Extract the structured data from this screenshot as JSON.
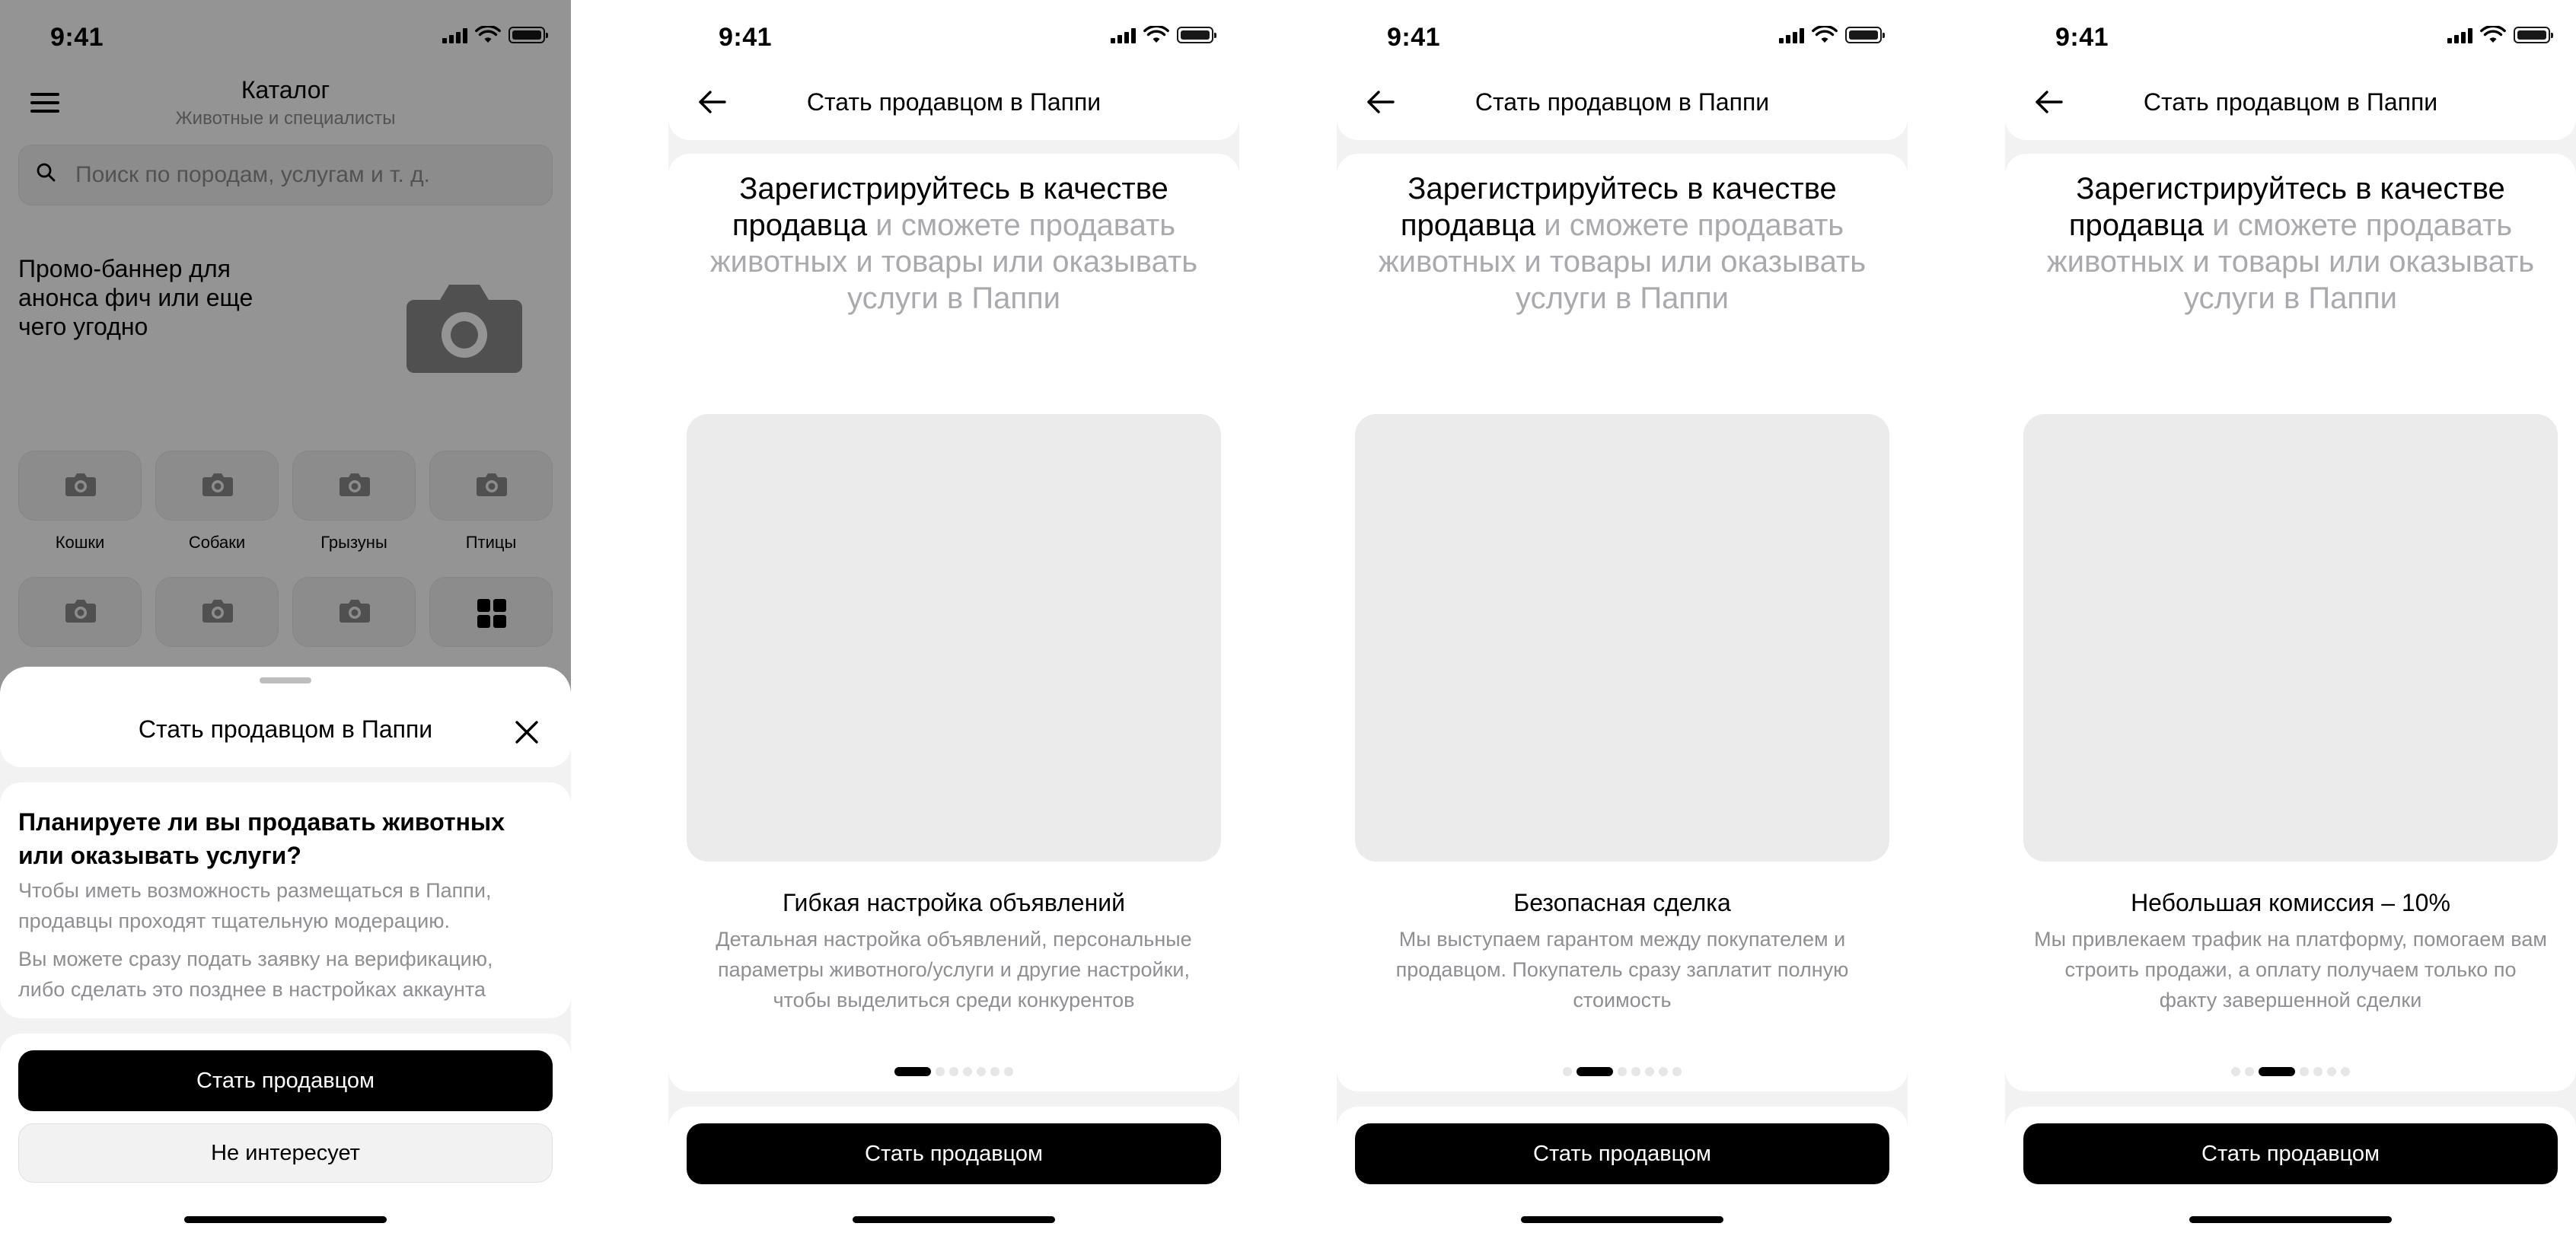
{
  "status": {
    "time": "9:41"
  },
  "catalog": {
    "title": "Каталог",
    "subtitle": "Животные и специалисты",
    "search_placeholder": "Поиск по породам, услугам и т. д.",
    "promo_text": "Промо-баннер для анонса фич или еще чего угодно",
    "categories": [
      "Кошки",
      "Собаки",
      "Грызуны",
      "Птицы"
    ]
  },
  "sheet": {
    "title": "Стать продавцом в Паппи",
    "question": "Планируете ли вы продавать животных или оказывать услуги?",
    "paragraph1": "Чтобы иметь возможность размещаться в Паппи, продавцы проходят тщательную модерацию.",
    "paragraph2": "Вы можете сразу подать заявку на верификацию, либо сделать это позднее в настройках аккаунта",
    "primary_button": "Стать продавцом",
    "secondary_button": "Не интересует"
  },
  "onboarding": {
    "title": "Стать продавцом в Паппи",
    "hero_dark": "Зарегистрируйтесь в качестве продавца",
    "hero_light": " и сможете продавать животных и товары или оказывать услуги в Паппи",
    "button": "Стать продавцом",
    "dots_total": 7,
    "slides": [
      {
        "feature": "Гибкая настройка объявлений",
        "description": "Детальная настройка объявлений, персональные параметры животного/услуги и другие настройки, чтобы выделиться среди конкурентов",
        "active_index": 0
      },
      {
        "feature": "Безопасная сделка",
        "description": "Мы выступаем гарантом между покупателем и продавцом. Покупатель сразу заплатит полную стоимость",
        "active_index": 1
      },
      {
        "feature": "Небольшая комиссия – 10%",
        "description": "Мы привлекаем трафик на платформу, помогаем вам строить продажи, а оплату получаем только по факту завершенной сделки",
        "active_index": 2
      }
    ]
  }
}
